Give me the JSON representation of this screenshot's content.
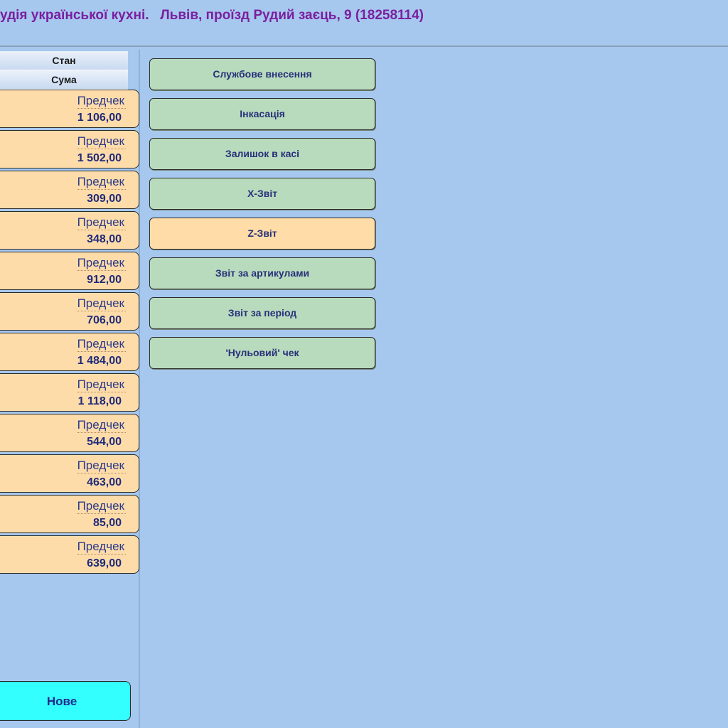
{
  "header": {
    "title": "удія української кухні.   Львів, проїзд Рудий заєць, 9 (18258114)"
  },
  "columns": {
    "status": "Стан",
    "sum": "Сума"
  },
  "orders": [
    {
      "status": "Предчек",
      "sum": "1 106,00"
    },
    {
      "status": "Предчек",
      "sum": "1 502,00"
    },
    {
      "status": "Предчек",
      "sum": "309,00"
    },
    {
      "status": "Предчек",
      "sum": "348,00"
    },
    {
      "status": "Предчек",
      "sum": "912,00"
    },
    {
      "status": "Предчек",
      "sum": "706,00"
    },
    {
      "status": "Предчек",
      "sum": "1 484,00"
    },
    {
      "status": "Предчек",
      "sum": "1 118,00"
    },
    {
      "status": "Предчек",
      "sum": "544,00"
    },
    {
      "status": "Предчек",
      "sum": "463,00"
    },
    {
      "status": "Предчек",
      "sum": "85,00"
    },
    {
      "status": "Предчек",
      "sum": "639,00"
    }
  ],
  "new_button": "Нове",
  "actions": [
    {
      "label": "Службове внесення",
      "name": "service-deposit-button"
    },
    {
      "label": "Інкасація",
      "name": "collection-button"
    },
    {
      "label": "Залишок в касі",
      "name": "cash-balance-button"
    },
    {
      "label": "X-Звіт",
      "name": "x-report-button"
    },
    {
      "label": "Z-Звіт",
      "name": "z-report-button",
      "highlight": true
    },
    {
      "label": "Звіт за артикулами",
      "name": "articles-report-button"
    },
    {
      "label": "Звіт за період",
      "name": "period-report-button"
    },
    {
      "label": "'Нульовий' чек",
      "name": "zero-receipt-button"
    }
  ],
  "colors": {
    "background": "#a6c8ee",
    "title": "#7a1fa0",
    "order_card": "#fedcaa",
    "action_button": "#b9dbbd",
    "action_highlight": "#ffdca8",
    "new_button": "#33ffff"
  }
}
